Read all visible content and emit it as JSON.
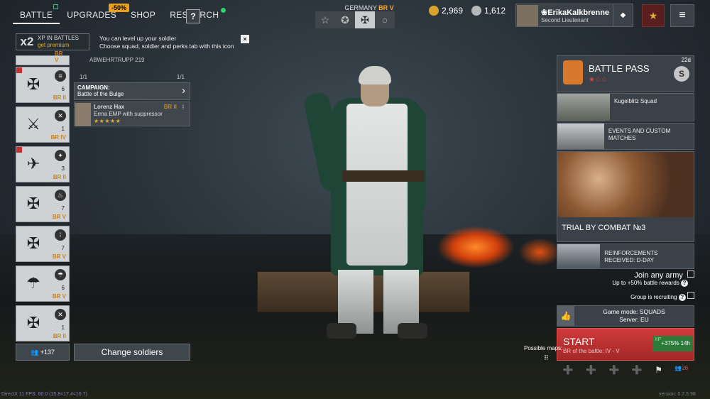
{
  "nav": {
    "tabs": [
      {
        "label": "BATTLE"
      },
      {
        "label": "UPGRADES"
      },
      {
        "label": "SHOP"
      },
      {
        "label": "RESEARCH"
      }
    ],
    "sale": "-50%",
    "help": "?"
  },
  "nation": {
    "name": "GERMANY",
    "br": "BR V",
    "icons": [
      "star-outline-icon",
      "star-circle-icon",
      "balkenkreuz-icon",
      "circle-icon"
    ]
  },
  "currency": {
    "gold": "2,969",
    "silver": "1,612"
  },
  "profile": {
    "name": "❀ErikaKalkbrenner",
    "rank": "Second Lieutenant"
  },
  "xp": {
    "mult": "x2",
    "line1": "XP IN BATTLES",
    "line2": "get premium"
  },
  "tip": {
    "line1": "You can level up your soldier",
    "line2": "Choose squad, soldier and perks tab with this icon",
    "close": "×"
  },
  "squads": [
    {
      "br": "BR V",
      "count": "",
      "emblem": "⚔"
    },
    {
      "br": "BR II",
      "count": "6",
      "emblem": "✠"
    },
    {
      "br": "BR IV",
      "count": "1",
      "emblem": "⚔"
    },
    {
      "br": "BR II",
      "count": "3",
      "emblem": "✈"
    },
    {
      "br": "BR V",
      "count": "7",
      "emblem": "✠"
    },
    {
      "br": "BR V",
      "count": "7",
      "emblem": "✠"
    },
    {
      "br": "BR V",
      "count": "6",
      "emblem": "☂"
    },
    {
      "br": "BR II",
      "count": "1",
      "emblem": "✠"
    }
  ],
  "squad_detail": {
    "name": "ABWEHRTRUPP 219",
    "slots_left": "1/1",
    "slots_right": "1/1",
    "campaign_label": "CAMPAIGN:",
    "campaign": "Battle of the Bulge"
  },
  "soldier": {
    "name": "Lorenz Hax",
    "weapon": "Erma EMP with suppressor",
    "br": "BR II",
    "stars": "★★★★★"
  },
  "bottom_left": {
    "reserve": "+137",
    "change": "Change soldiers"
  },
  "battle_pass": {
    "title": "BATTLE PASS",
    "days": "22d",
    "stars": "★☆☆",
    "coin": "S"
  },
  "events": [
    {
      "label": "Kugelblitz Squad"
    },
    {
      "label": "EVENTS AND CUSTOM MATCHES"
    }
  ],
  "combat": {
    "label": "TRIAL BY COMBAT №3"
  },
  "reinforce": {
    "label": "REINFORCEMENTS RECEIVED: D-DAY"
  },
  "join": {
    "title": "Join any army",
    "sub": "Up to +50% battle rewards",
    "group": "Group is recruiting"
  },
  "gamemode": {
    "line1": "Game mode: SQUADS",
    "line2": "Server: EU"
  },
  "start": {
    "label": "START",
    "sub": "BR of the battle: IV - V",
    "bonus": "+375% 14h",
    "xp": "XP"
  },
  "maps": {
    "label": "Possible maps:"
  },
  "bottom_icons": [
    "➕",
    "➕",
    "➕",
    "➕",
    "⚑",
    "26"
  ],
  "footer": {
    "left": "DirectX 11 FPS: 60.0 (15.8<17.4<16.7)",
    "version": "version: 0.7.5.98"
  }
}
